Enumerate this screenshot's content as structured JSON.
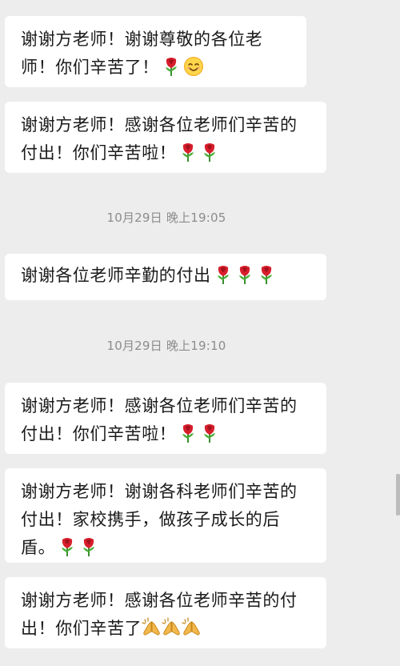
{
  "messages": [
    {
      "text": "谢谢方老师！谢谢尊敬的各位老师！你们辛苦了！",
      "emoji": [
        "rose-icon",
        "smiling-face-icon"
      ]
    },
    {
      "text": "谢谢方老师！感谢各位老师们辛苦的付出！你们辛苦啦！",
      "emoji": [
        "rose-icon",
        "rose-icon"
      ]
    },
    {
      "text": "谢谢各位老师辛勤的付出",
      "emoji": [
        "rose-icon",
        "rose-icon",
        "rose-icon"
      ]
    },
    {
      "text": "谢谢方老师！感谢各位老师们辛苦的付出！你们辛苦啦！",
      "emoji": [
        "rose-icon",
        "rose-icon"
      ]
    },
    {
      "text": "谢谢方老师！谢谢各科老师们辛苦的付出！家校携手，做孩子成长的后盾。",
      "emoji": [
        "rose-icon",
        "rose-icon"
      ]
    },
    {
      "text": "谢谢方老师！感谢各位老师辛苦的付出！你们辛苦了",
      "emoji": [
        "praying-hands-icon",
        "praying-hands-icon",
        "praying-hands-icon"
      ]
    }
  ],
  "timestamps": [
    "10月29日 晚上19:05",
    "10月29日 晚上19:10"
  ],
  "colors": {
    "background": "#ededed",
    "bubble": "#ffffff",
    "text": "#1a1a1a",
    "timestamp": "#8c8c8c"
  }
}
